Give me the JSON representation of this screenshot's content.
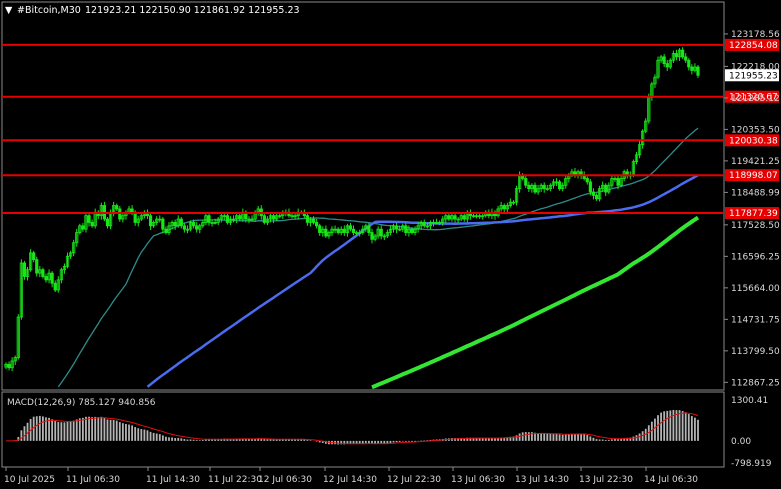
{
  "header": {
    "symbol": "#Bitcoin,M30",
    "ohlc": "121923.21 122150.90 121861.92 121955.23"
  },
  "indicator": {
    "label": "MACD(12,26,9) 785.127 940.856"
  },
  "colors": {
    "background": "#000000",
    "bull": "#19e619",
    "hline": "#e60000",
    "ma_fast": "#2e8b8b",
    "ma_mid": "#4a6cf0",
    "ma_slow": "#33e633",
    "macd_hist": "#b4b4b4",
    "macd_signal": "#e01010",
    "axis_text": "#d8d8d8"
  },
  "chart_data": [
    {
      "type": "line",
      "subtype": "candlestick",
      "title": "#Bitcoin,M30",
      "price_axis_ticks": [
        "123178.56",
        "122218.00",
        "121285.12",
        "120353.50",
        "119421.25",
        "118488.99",
        "117528.50",
        "116596.25",
        "115664.00",
        "114731.75",
        "113799.50",
        "112867.25"
      ],
      "price_axis_range": [
        112700,
        123650
      ],
      "last_price": "121955.23",
      "horizontal_levels": [
        {
          "value": 122854.08,
          "label": "122854.08"
        },
        {
          "value": 121320.67,
          "label": "121320.67"
        },
        {
          "value": 120030.38,
          "label": "120030.38"
        },
        {
          "value": 118998.07,
          "label": "118998.07"
        },
        {
          "value": 117877.39,
          "label": "117877.39"
        }
      ],
      "time_axis_ticks": [
        "10 Jul 2025",
        "11 Jul 06:30",
        "11 Jul 14:30",
        "11 Jul 22:30",
        "12 Jul 06:30",
        "12 Jul 14:30",
        "12 Jul 22:30",
        "13 Jul 06:30",
        "13 Jul 14:30",
        "13 Jul 22:30",
        "14 Jul 06:30"
      ],
      "close_series": [
        113400,
        113300,
        113500,
        113600,
        114800,
        116400,
        116000,
        116200,
        116700,
        116500,
        116100,
        116200,
        116000,
        115900,
        116100,
        115800,
        115600,
        115900,
        116200,
        116300,
        116600,
        116700,
        117000,
        117300,
        117500,
        117400,
        117800,
        117600,
        117500,
        117900,
        117800,
        118100,
        117700,
        117500,
        117900,
        118100,
        118000,
        117700,
        117800,
        117900,
        118000,
        117900,
        117600,
        117700,
        117800,
        117900,
        117800,
        117500,
        117600,
        117700,
        117700,
        117400,
        117300,
        117500,
        117600,
        117500,
        117700,
        117500,
        117400,
        117400,
        117600,
        117500,
        117400,
        117500,
        117600,
        117800,
        117600,
        117600,
        117600,
        117700,
        117800,
        117800,
        117600,
        117700,
        117700,
        117800,
        117700,
        117900,
        117700,
        117700,
        117700,
        117900,
        118000,
        117800,
        117600,
        117700,
        117800,
        117700,
        117800,
        117800,
        117900,
        117900,
        117800,
        117800,
        117800,
        117900,
        117900,
        117800,
        117600,
        117700,
        117600,
        117500,
        117300,
        117400,
        117200,
        117300,
        117400,
        117400,
        117300,
        117400,
        117300,
        117500,
        117400,
        117300,
        117300,
        117300,
        117400,
        117500,
        117300,
        117100,
        117200,
        117400,
        117200,
        117200,
        117300,
        117400,
        117500,
        117400,
        117400,
        117500,
        117300,
        117400,
        117300,
        117400,
        117500,
        117600,
        117500,
        117500,
        117600,
        117600,
        117600,
        117600,
        117700,
        117800,
        117700,
        117800,
        117700,
        117700,
        117800,
        117700,
        117900,
        117800,
        117800,
        117800,
        117800,
        117800,
        117900,
        117800,
        117900,
        117800,
        118000,
        118100,
        118000,
        118100,
        118200,
        118200,
        118600,
        119000,
        118900,
        118700,
        118600,
        118700,
        118500,
        118600,
        118700,
        118600,
        118600,
        118700,
        118800,
        118800,
        118600,
        118700,
        118900,
        119000,
        119100,
        119000,
        119100,
        119000,
        118900,
        118800,
        118500,
        118400,
        118300,
        118600,
        118700,
        118500,
        118700,
        118900,
        118900,
        118700,
        118900,
        119100,
        119000,
        119000,
        119400,
        119600,
        119900,
        120300,
        120600,
        121300,
        121700,
        121900,
        122400,
        122500,
        122300,
        122200,
        122400,
        122600,
        122500,
        122700,
        122500,
        122400,
        122200,
        122100,
        122200,
        121955
      ],
      "ma_fast_label": "moving average (teal)",
      "macd_axis_ticks": [
        "1300.41",
        "0.00",
        "-798.919"
      ]
    }
  ]
}
